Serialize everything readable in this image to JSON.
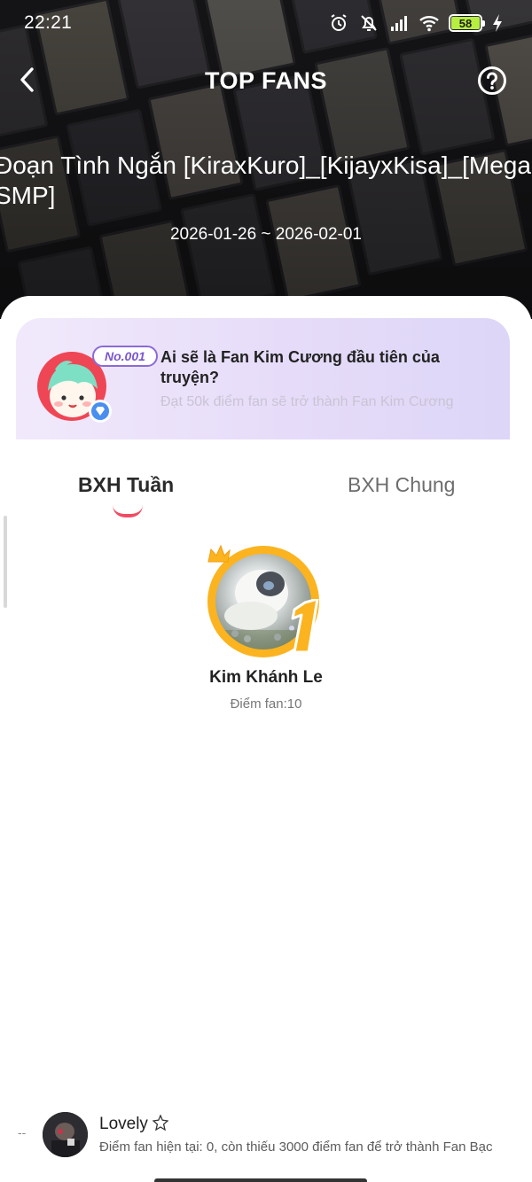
{
  "status_bar": {
    "time": "22:21",
    "battery": "58",
    "icons": [
      "alarm-icon",
      "bell-off-icon",
      "signal-icon",
      "wifi-icon",
      "battery-icon",
      "charging-icon"
    ]
  },
  "nav": {
    "title": "TOP FANS",
    "back_icon": "chevron-left-icon",
    "help_icon": "question-circle-icon"
  },
  "story": {
    "title_line1": "Đoạn Tình Ngắn [KiraxKuro]_[KijayxKisa]_[Mega",
    "title_line2": "SMP]",
    "date_range": "2026-01-26 ~ 2026-02-01"
  },
  "banner": {
    "rank_tag": "No.001",
    "title": "Ai sẽ là Fan Kim Cương đầu tiên của truyện?",
    "subtitle": "Đạt 50k điểm fan sẽ trở thành Fan Kim Cương"
  },
  "tabs": [
    {
      "label": "BXH Tuần",
      "active": true
    },
    {
      "label": "BXH Chung",
      "active": false
    }
  ],
  "top_fan": {
    "rank": "1",
    "name": "Kim Khánh Le",
    "score": "Điểm fan:10"
  },
  "my_rank": {
    "rank": "--",
    "name": "Lovely",
    "description": "Điểm fan hiện tại: 0, còn thiếu 3000 điểm fan để trở thành Fan Bạc"
  },
  "colors": {
    "accent": "#f14b64",
    "gold": "#fbb41f",
    "banner_purple": "#7a56cf",
    "battery_green": "#b6ef3f"
  }
}
